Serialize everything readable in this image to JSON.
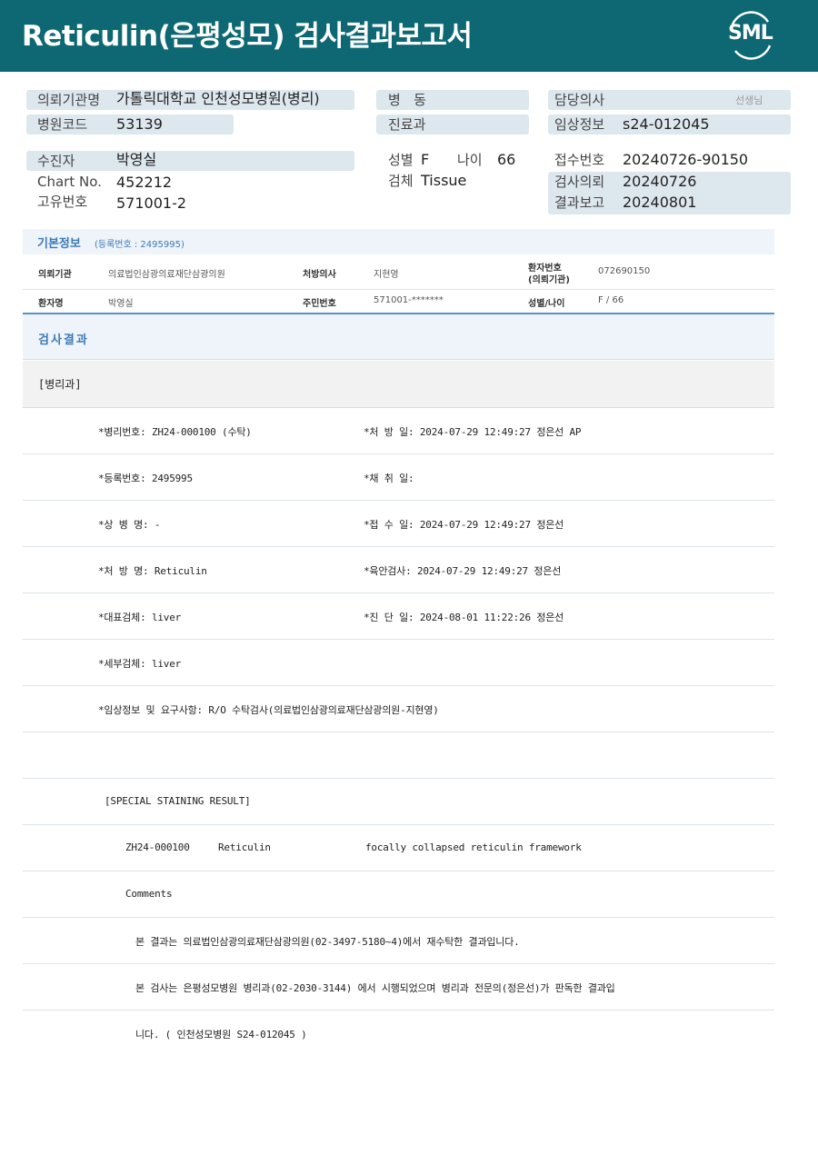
{
  "header": {
    "title": "Reticulin(은평성모) 검사결과보고서",
    "logo_text": "SML"
  },
  "info": {
    "requesting_institution_label": "의뢰기관명",
    "requesting_institution_value": "가톨릭대학교 인천성모병원(병리)",
    "hospital_code_label": "병원코드",
    "hospital_code_value": "53139",
    "ward_label": "병   동",
    "department_label": "진료과",
    "doctor_label": "담당의사",
    "doctor_suffix": "선생님",
    "clinical_info_label": "임상정보",
    "clinical_info_value": "s24-012045",
    "patient_label": "수진자",
    "patient_value": "박영실",
    "chart_label": "Chart No.",
    "chart_value": "452212",
    "unique_id_label": "고유번호",
    "unique_id_value": "571001-2",
    "sex_label": "성별",
    "sex_value": "F",
    "age_label": "나이",
    "age_value": "66",
    "specimen_label": "검체",
    "specimen_value": "Tissue",
    "receipt_no_label": "접수번호",
    "receipt_no_value": "20240726-90150",
    "test_request_label": "검사의뢰",
    "test_request_value": "20240726",
    "result_report_label": "결과보고",
    "result_report_value": "20240801"
  },
  "basic": {
    "title": "기본정보",
    "registration": "(등록번호 : 2495995)",
    "row1": {
      "k1": "의뢰기관",
      "v1": "의료법인삼광의료재단삼광의원",
      "k2": "처방의사",
      "v2": "지현영",
      "k3_line1": "환자번호",
      "k3_line2": "(의뢰기관)",
      "v3": "072690150"
    },
    "row2": {
      "k1": "환자명",
      "v1": "박영실",
      "k2": "주민번호",
      "v2": "571001-*******",
      "k3": "성별/나이",
      "v3": "F / 66"
    }
  },
  "results": {
    "title": "검사결과",
    "department": "[병리과]",
    "rows": [
      {
        "left": "*병리번호: ZH24-000100 (수탁)",
        "right": "*처 방 일: 2024-07-29 12:49:27  정은선 AP"
      },
      {
        "left": "*등록번호: 2495995",
        "right": "*채 취 일:"
      },
      {
        "left": "*상 병 명: -",
        "right": "*접 수 일: 2024-07-29 12:49:27  정은선"
      },
      {
        "left": "*처 방 명: Reticulin",
        "right": "*육안검사: 2024-07-29 12:49:27  정은선"
      },
      {
        "left": "*대표검체: liver",
        "right": "*진 단 일: 2024-08-01 11:22:26  정은선"
      },
      {
        "left": "*세부검체: liver",
        "right": ""
      },
      {
        "left": "*임상정보 및 요구사항: R/O 수탁검사(의료법인삼광의료재단삼광의원-지현영)",
        "right": ""
      }
    ],
    "special_heading": "[SPECIAL STAINING RESULT]",
    "stain_id": "ZH24-000100",
    "stain_name": "Reticulin",
    "stain_result": "focally collapsed reticulin framework",
    "comments_label": "Comments",
    "comment1": "본 결과는 의료법인삼광의료재단삼광의원(02-3497-5180~4)에서 재수탁한 결과입니다.",
    "comment2": "본 검사는 은평성모병원 병리과(02-2030-3144) 에서 시행되었으며 병리과 전문의(정은선)가 판독한 결과입",
    "comment3": "니다. ( 인천성모병원 S24-012045 )"
  }
}
